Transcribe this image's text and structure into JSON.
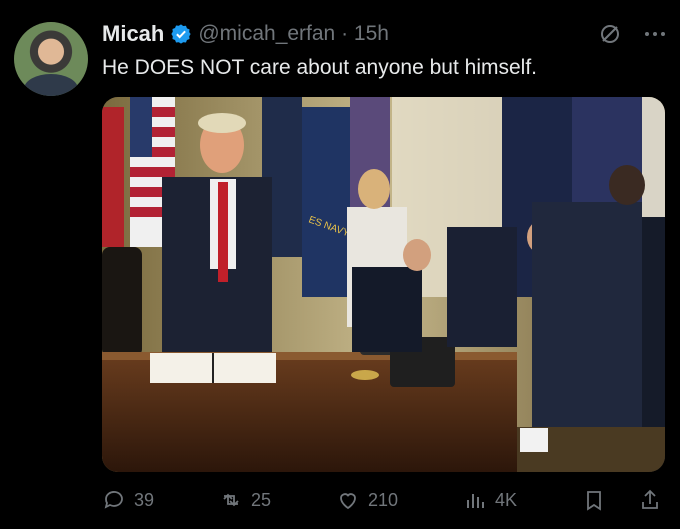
{
  "author": {
    "name": "Micah",
    "handle": "@micah_erfan",
    "time": "15h",
    "verified_color": "#1d9bf0"
  },
  "tweet": {
    "text": "He DOES NOT care about anyone but himself."
  },
  "media": {
    "type": "photo",
    "flag_text": "ES NAVY"
  },
  "actions": {
    "replies": "39",
    "reposts": "25",
    "likes": "210",
    "views": "4K"
  },
  "icons": {
    "grok": "grok-icon",
    "more": "more-icon",
    "reply": "reply-icon",
    "repost": "repost-icon",
    "like": "heart-icon",
    "views": "views-icon",
    "bookmark": "bookmark-icon",
    "share": "share-icon"
  }
}
